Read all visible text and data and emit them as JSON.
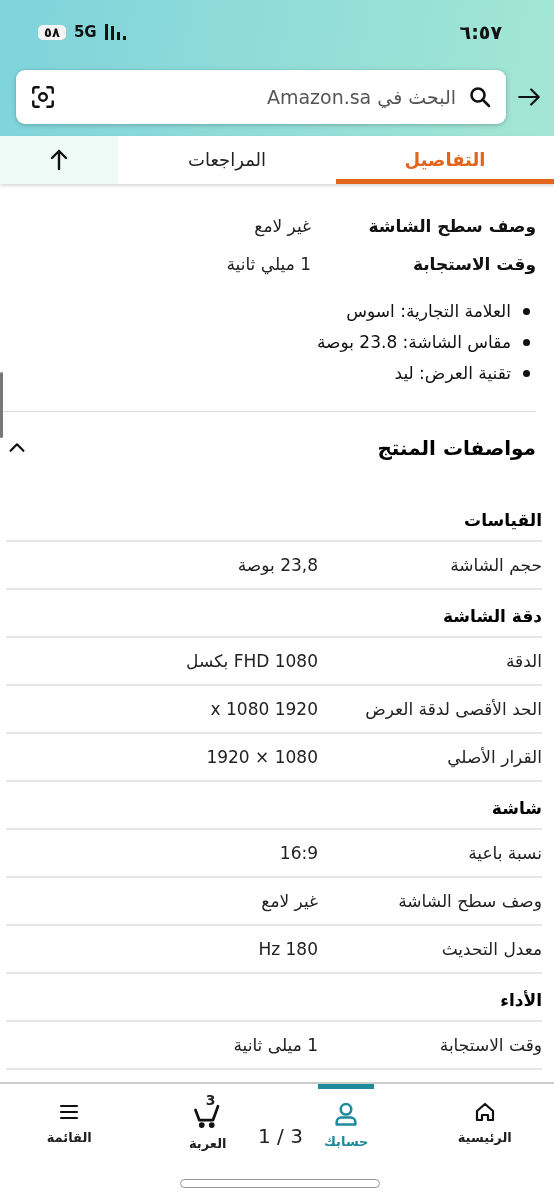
{
  "status_bar": {
    "time": "٦:٥٧",
    "network": "5G",
    "battery": "٥٨"
  },
  "search": {
    "placeholder": "البحث في Amazon.sa"
  },
  "tabs": [
    {
      "label": "التفاصيل",
      "selected": true
    },
    {
      "label": "المراجعات",
      "selected": false
    }
  ],
  "details": [
    {
      "label": "وصف سطح الشاشة",
      "value": "غير لامع"
    },
    {
      "label": "وقت الاستجابة",
      "value": "1 ميلي ثانية"
    }
  ],
  "bullets": [
    "العلامة التجارية: اسوس",
    "مقاس الشاشة: 23.8 بوصة",
    "تقنية العرض: ليد"
  ],
  "specs_section": {
    "title": "مواصفات المنتج",
    "expanded": true,
    "groups": [
      {
        "title": "القياسات",
        "rows": [
          {
            "label": "حجم الشاشة",
            "value": "23,8 بوصة"
          }
        ]
      },
      {
        "title": "دقة الشاشة",
        "rows": [
          {
            "label": "الدقة",
            "value": "FHD 1080 بكسل"
          },
          {
            "label": "الحد الأقصى لدقة العرض",
            "value": "x 1080 1920"
          },
          {
            "label": "القرار الأصلي",
            "value": "1080 × 1920"
          }
        ]
      },
      {
        "title": "شاشة",
        "rows": [
          {
            "label": "نسبة باعية",
            "value": "16:9"
          },
          {
            "label": "وصف سطح الشاشة",
            "value": "غير لامع"
          },
          {
            "label": "معدل التحديث",
            "value": "Hz 180"
          }
        ]
      },
      {
        "title": "الأداء",
        "rows": [
          {
            "label": "وقت الاستجابة",
            "value": "1 ميلى ثانية"
          }
        ]
      }
    ]
  },
  "bottom_nav": [
    {
      "kind": "home",
      "label": "الرئيسية",
      "selected": false
    },
    {
      "kind": "account",
      "label": "حسابك",
      "selected": true
    },
    {
      "kind": "cart",
      "label": "العربة",
      "badge": "3",
      "selected": false
    },
    {
      "kind": "menu",
      "label": "القائمة",
      "selected": false
    }
  ],
  "page_counter": "1 / 3"
}
